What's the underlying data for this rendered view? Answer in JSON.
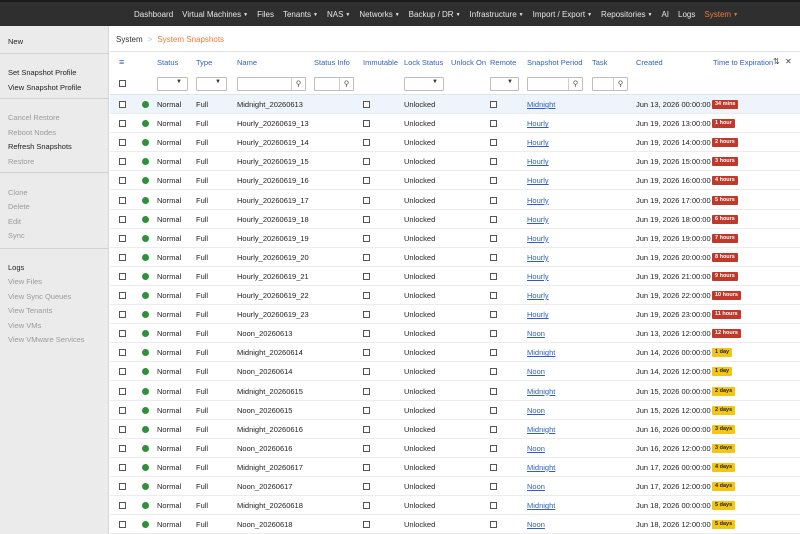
{
  "topnav": {
    "items": [
      {
        "label": "Dashboard",
        "caret": false
      },
      {
        "label": "Virtual Machines",
        "caret": true
      },
      {
        "label": "Files",
        "caret": false
      },
      {
        "label": "Tenants",
        "caret": true
      },
      {
        "label": "NAS",
        "caret": true
      },
      {
        "label": "Networks",
        "caret": true
      },
      {
        "label": "Backup / DR",
        "caret": true
      },
      {
        "label": "Infrastructure",
        "caret": true
      },
      {
        "label": "Import / Export",
        "caret": true
      },
      {
        "label": "Repositories",
        "caret": true
      },
      {
        "label": "AI",
        "caret": false
      },
      {
        "label": "Logs",
        "caret": false
      },
      {
        "label": "System",
        "caret": true
      }
    ],
    "active_color": "#f07a3a"
  },
  "sidebar": {
    "groups": [
      [
        {
          "label": "New",
          "enabled": true
        }
      ],
      [
        {
          "label": "Set Snapshot Profile",
          "enabled": true
        },
        {
          "label": "View Snapshot Profile",
          "enabled": true
        }
      ],
      [
        {
          "label": "Cancel Restore",
          "enabled": false
        },
        {
          "label": "Reboot Nodes",
          "enabled": false
        },
        {
          "label": "Refresh Snapshots",
          "enabled": true
        },
        {
          "label": "Restore",
          "enabled": false
        }
      ],
      [
        {
          "label": "Clone",
          "enabled": false
        },
        {
          "label": "Delete",
          "enabled": false
        },
        {
          "label": "Edit",
          "enabled": false
        },
        {
          "label": "Sync",
          "enabled": false
        }
      ],
      [
        {
          "label": "Logs",
          "enabled": true
        },
        {
          "label": "View Files",
          "enabled": false
        },
        {
          "label": "View Sync Queues",
          "enabled": false
        },
        {
          "label": "View Tenants",
          "enabled": false
        },
        {
          "label": "View VMs",
          "enabled": false
        },
        {
          "label": "View VMware Services",
          "enabled": false
        }
      ]
    ]
  },
  "breadcrumb": {
    "root": "System",
    "separator": ">",
    "current": "System Snapshots"
  },
  "table": {
    "menu_icon": "≡",
    "columns": [
      "Status",
      "Type",
      "Name",
      "Status Info",
      "Immutable",
      "Lock Status",
      "Unlock On",
      "Remote",
      "Snapshot Period",
      "Task",
      "Created",
      "Time to Expiration"
    ],
    "controls": {
      "resize_icon": "⇅",
      "close_icon": "✕"
    },
    "search_icon": "⚲",
    "dropdown_icon": "▼",
    "rows": [
      {
        "status": "Normal",
        "type": "Full",
        "name": "Midnight_20260613",
        "lock": "Unlocked",
        "period": "Midnight",
        "created": "Jun 13, 2026 00:00:00",
        "expiration": "34 mins",
        "exp_color": "red"
      },
      {
        "status": "Normal",
        "type": "Full",
        "name": "Hourly_20260619_13",
        "lock": "Unlocked",
        "period": "Hourly",
        "created": "Jun 19, 2026 13:00:00",
        "expiration": "1 hour",
        "exp_color": "red"
      },
      {
        "status": "Normal",
        "type": "Full",
        "name": "Hourly_20260619_14",
        "lock": "Unlocked",
        "period": "Hourly",
        "created": "Jun 19, 2026 14:00:00",
        "expiration": "2 hours",
        "exp_color": "red"
      },
      {
        "status": "Normal",
        "type": "Full",
        "name": "Hourly_20260619_15",
        "lock": "Unlocked",
        "period": "Hourly",
        "created": "Jun 19, 2026 15:00:00",
        "expiration": "3 hours",
        "exp_color": "red"
      },
      {
        "status": "Normal",
        "type": "Full",
        "name": "Hourly_20260619_16",
        "lock": "Unlocked",
        "period": "Hourly",
        "created": "Jun 19, 2026 16:00:00",
        "expiration": "4 hours",
        "exp_color": "red"
      },
      {
        "status": "Normal",
        "type": "Full",
        "name": "Hourly_20260619_17",
        "lock": "Unlocked",
        "period": "Hourly",
        "created": "Jun 19, 2026 17:00:00",
        "expiration": "5 hours",
        "exp_color": "red"
      },
      {
        "status": "Normal",
        "type": "Full",
        "name": "Hourly_20260619_18",
        "lock": "Unlocked",
        "period": "Hourly",
        "created": "Jun 19, 2026 18:00:00",
        "expiration": "6 hours",
        "exp_color": "red"
      },
      {
        "status": "Normal",
        "type": "Full",
        "name": "Hourly_20260619_19",
        "lock": "Unlocked",
        "period": "Hourly",
        "created": "Jun 19, 2026 19:00:00",
        "expiration": "7 hours",
        "exp_color": "red"
      },
      {
        "status": "Normal",
        "type": "Full",
        "name": "Hourly_20260619_20",
        "lock": "Unlocked",
        "period": "Hourly",
        "created": "Jun 19, 2026 20:00:00",
        "expiration": "8 hours",
        "exp_color": "red"
      },
      {
        "status": "Normal",
        "type": "Full",
        "name": "Hourly_20260619_21",
        "lock": "Unlocked",
        "period": "Hourly",
        "created": "Jun 19, 2026 21:00:00",
        "expiration": "9 hours",
        "exp_color": "red"
      },
      {
        "status": "Normal",
        "type": "Full",
        "name": "Hourly_20260619_22",
        "lock": "Unlocked",
        "period": "Hourly",
        "created": "Jun 19, 2026 22:00:00",
        "expiration": "10 hours",
        "exp_color": "red"
      },
      {
        "status": "Normal",
        "type": "Full",
        "name": "Hourly_20260619_23",
        "lock": "Unlocked",
        "period": "Hourly",
        "created": "Jun 19, 2026 23:00:00",
        "expiration": "11 hours",
        "exp_color": "red"
      },
      {
        "status": "Normal",
        "type": "Full",
        "name": "Noon_20260613",
        "lock": "Unlocked",
        "period": "Noon",
        "created": "Jun 13, 2026 12:00:00",
        "expiration": "12 hours",
        "exp_color": "red"
      },
      {
        "status": "Normal",
        "type": "Full",
        "name": "Midnight_20260614",
        "lock": "Unlocked",
        "period": "Midnight",
        "created": "Jun 14, 2026 00:00:00",
        "expiration": "1 day",
        "exp_color": "yellow"
      },
      {
        "status": "Normal",
        "type": "Full",
        "name": "Noon_20260614",
        "lock": "Unlocked",
        "period": "Noon",
        "created": "Jun 14, 2026 12:00:00",
        "expiration": "1 day",
        "exp_color": "yellow"
      },
      {
        "status": "Normal",
        "type": "Full",
        "name": "Midnight_20260615",
        "lock": "Unlocked",
        "period": "Midnight",
        "created": "Jun 15, 2026 00:00:00",
        "expiration": "2 days",
        "exp_color": "yellow"
      },
      {
        "status": "Normal",
        "type": "Full",
        "name": "Noon_20260615",
        "lock": "Unlocked",
        "period": "Noon",
        "created": "Jun 15, 2026 12:00:00",
        "expiration": "2 days",
        "exp_color": "yellow"
      },
      {
        "status": "Normal",
        "type": "Full",
        "name": "Midnight_20260616",
        "lock": "Unlocked",
        "period": "Midnight",
        "created": "Jun 16, 2026 00:00:00",
        "expiration": "3 days",
        "exp_color": "yellow"
      },
      {
        "status": "Normal",
        "type": "Full",
        "name": "Noon_20260616",
        "lock": "Unlocked",
        "period": "Noon",
        "created": "Jun 16, 2026 12:00:00",
        "expiration": "3 days",
        "exp_color": "yellow"
      },
      {
        "status": "Normal",
        "type": "Full",
        "name": "Midnight_20260617",
        "lock": "Unlocked",
        "period": "Midnight",
        "created": "Jun 17, 2026 00:00:00",
        "expiration": "4 days",
        "exp_color": "yellow"
      },
      {
        "status": "Normal",
        "type": "Full",
        "name": "Noon_20260617",
        "lock": "Unlocked",
        "period": "Noon",
        "created": "Jun 17, 2026 12:00:00",
        "expiration": "4 days",
        "exp_color": "yellow"
      },
      {
        "status": "Normal",
        "type": "Full",
        "name": "Midnight_20260618",
        "lock": "Unlocked",
        "period": "Midnight",
        "created": "Jun 18, 2026 00:00:00",
        "expiration": "5 days",
        "exp_color": "yellow"
      },
      {
        "status": "Normal",
        "type": "Full",
        "name": "Noon_20260618",
        "lock": "Unlocked",
        "period": "Noon",
        "created": "Jun 18, 2026 12:00:00",
        "expiration": "5 days",
        "exp_color": "yellow"
      }
    ]
  }
}
